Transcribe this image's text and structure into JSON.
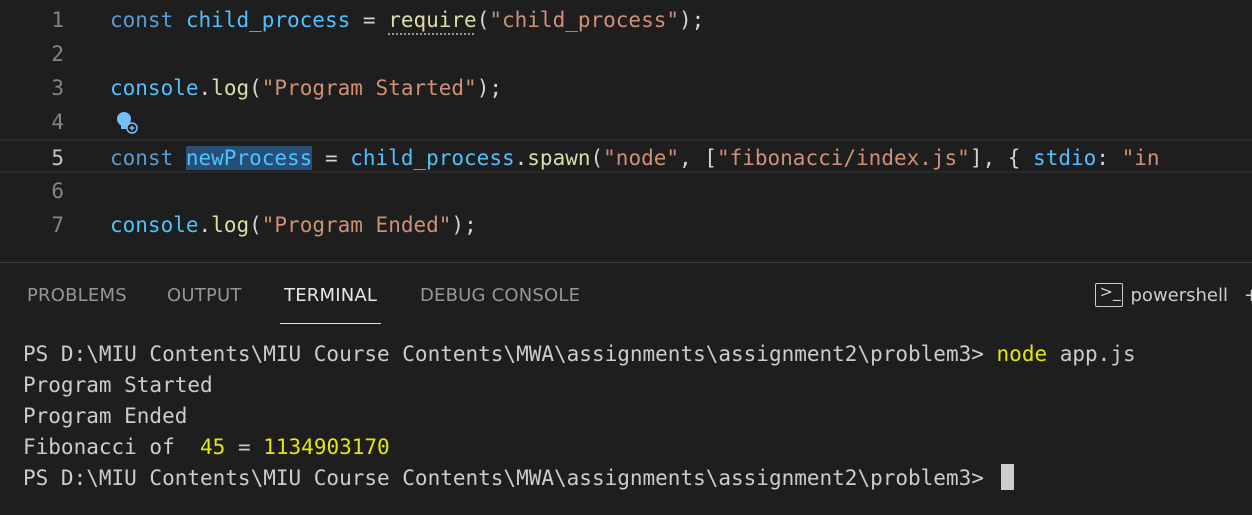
{
  "editor": {
    "lines": [
      {
        "n": "1",
        "t": [
          {
            "c": "kw",
            "v": "const"
          },
          {
            "c": "pun",
            "v": " "
          },
          {
            "c": "var",
            "v": "child_process"
          },
          {
            "c": "pun",
            "v": " = "
          },
          {
            "c": "fn",
            "v": "require"
          },
          {
            "c": "pun",
            "v": "("
          },
          {
            "c": "str",
            "v": "\"child_process\""
          },
          {
            "c": "pun",
            "v": ");"
          }
        ]
      },
      {
        "n": "2",
        "t": []
      },
      {
        "n": "3",
        "t": [
          {
            "c": "var",
            "v": "console"
          },
          {
            "c": "pun",
            "v": "."
          },
          {
            "c": "fn",
            "v": "log"
          },
          {
            "c": "pun",
            "v": "("
          },
          {
            "c": "str",
            "v": "\"Program Started\""
          },
          {
            "c": "pun",
            "v": ");"
          }
        ]
      },
      {
        "n": "4",
        "t": []
      },
      {
        "n": "5",
        "t": [
          {
            "c": "kw",
            "v": "const"
          },
          {
            "c": "pun",
            "v": " "
          },
          {
            "c": "var",
            "v": "newProcess"
          },
          {
            "c": "pun",
            "v": " = "
          },
          {
            "c": "var",
            "v": "child_process"
          },
          {
            "c": "pun",
            "v": "."
          },
          {
            "c": "fn",
            "v": "spawn"
          },
          {
            "c": "pun",
            "v": "("
          },
          {
            "c": "str",
            "v": "\"node\""
          },
          {
            "c": "pun",
            "v": ", ["
          },
          {
            "c": "str",
            "v": "\"fibonacci/index.js\""
          },
          {
            "c": "pun",
            "v": "], { "
          },
          {
            "c": "var",
            "v": "stdio"
          },
          {
            "c": "pun",
            "v": ": "
          },
          {
            "c": "str",
            "v": "\"in"
          }
        ]
      },
      {
        "n": "6",
        "t": []
      },
      {
        "n": "7",
        "t": [
          {
            "c": "var",
            "v": "console"
          },
          {
            "c": "pun",
            "v": "."
          },
          {
            "c": "fn",
            "v": "log"
          },
          {
            "c": "pun",
            "v": "("
          },
          {
            "c": "str",
            "v": "\"Program Ended\""
          },
          {
            "c": "pun",
            "v": ");"
          }
        ]
      }
    ]
  },
  "panel": {
    "tabs": [
      {
        "id": "problems",
        "label": "PROBLEMS"
      },
      {
        "id": "output",
        "label": "OUTPUT"
      },
      {
        "id": "terminal",
        "label": "TERMINAL"
      },
      {
        "id": "debug-console",
        "label": "DEBUG CONSOLE"
      }
    ],
    "active_tab": "TERMINAL",
    "shell_name": "powershell",
    "shell_icon": "terminal-powershell-icon",
    "add_icon": "plus-icon"
  },
  "terminal": {
    "prompt_1": "PS D:\\MIU Contents\\MIU Course Contents\\MWA\\assignments\\assignment2\\problem3> ",
    "command": "node",
    "command_args": " app.js",
    "out_1": "Program Started",
    "out_2": "Program Ended",
    "fib_label": "Fibonacci of  ",
    "fib_n": "45",
    "fib_eq": " = ",
    "fib_result": "1134903170",
    "prompt_2": "PS D:\\MIU Contents\\MIU Course Contents\\MWA\\assignments\\assignment2\\problem3> "
  },
  "colors": {
    "keyword": "#569cd6",
    "variable": "#4fc1ff",
    "function": "#dcdcaa",
    "string": "#ce9178",
    "terminal_highlight": "#e5e510"
  }
}
